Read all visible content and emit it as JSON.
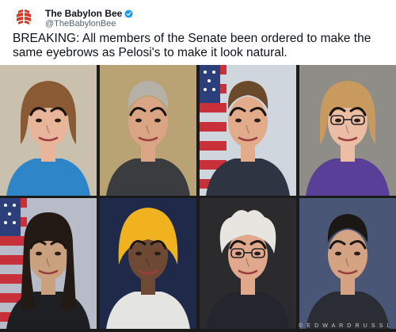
{
  "tweet": {
    "account_name": "The Babylon Bee",
    "handle": "@TheBabylonBee",
    "text": "BREAKING: All members of the Senate been ordered to make the same eyebrows as Pelosi's to make it look natural.",
    "brand_color": "#d33a26"
  },
  "photo_grid": {
    "watermark": "© E D W A R D R U S S L",
    "cells": [
      {
        "name": "photo-woman-blonde-blue-jacket",
        "bg": "#c9c0ae",
        "skin": "#e8b59a",
        "hair": "#8a5a34",
        "suit": "#2e86c9",
        "hair_style": "bob"
      },
      {
        "name": "photo-man-gray-hair-suit",
        "bg": "#b9a273",
        "skin": "#d9a585",
        "hair": "#b5b0a8",
        "suit": "#3b3c40",
        "hair_style": "short"
      },
      {
        "name": "photo-man-flag-background",
        "bg": "#cfd6de",
        "skin": "#e2ab8a",
        "hair": "#6b4a2c",
        "suit": "#2f3442",
        "hair_style": "short",
        "flag": true
      },
      {
        "name": "photo-woman-glasses-purple",
        "bg": "#8f8d88",
        "skin": "#ebbda4",
        "hair": "#c89a5e",
        "suit": "#5a3f98",
        "hair_style": "bob"
      },
      {
        "name": "photo-woman-dark-hair-flag",
        "bg": "#b8bcc8",
        "skin": "#caa17f",
        "hair": "#241a15",
        "suit": "#1e1f23",
        "hair_style": "long",
        "flag": true
      },
      {
        "name": "photo-woman-yellow-headscarf",
        "bg": "#1f2a4a",
        "skin": "#6e4a35",
        "hair": "#f0b21e",
        "suit": "#e4e4e0",
        "hair_style": "scarf"
      },
      {
        "name": "photo-man-white-hair-glasses",
        "bg": "#2b2b2e",
        "skin": "#e0a98e",
        "hair": "#e7e5e0",
        "suit": "#23262c",
        "hair_style": "wild"
      },
      {
        "name": "photo-man-dark-hair-suit",
        "bg": "#4a5676",
        "skin": "#d3a383",
        "hair": "#1b1714",
        "suit": "#2a2d33",
        "hair_style": "short"
      }
    ]
  }
}
